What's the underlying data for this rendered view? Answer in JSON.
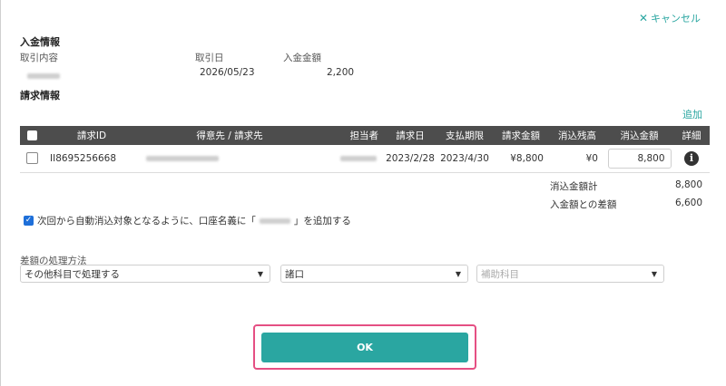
{
  "header": {
    "cancel_label": "キャンセル"
  },
  "payment_info": {
    "title": "入金情報",
    "col_content": "取引内容",
    "col_date": "取引日",
    "col_amount": "入金金額",
    "date": "2026/05/23",
    "amount": "2,200"
  },
  "billing_info": {
    "title": "請求情報",
    "add_label": "追加",
    "columns": [
      "請求ID",
      "得意先 / 請求先",
      "担当者",
      "請求日",
      "支払期限",
      "請求金額",
      "消込残高",
      "消込金額",
      "詳細"
    ],
    "rows": [
      {
        "id": "II8695256668",
        "invoice_date": "2023/2/28",
        "due_date": "2023/4/30",
        "amount": "¥8,800",
        "balance": "¥0",
        "reconcile_amount": "8,800"
      }
    ],
    "summary": [
      {
        "label": "消込金額計",
        "value": "8,800"
      },
      {
        "label": "入金額との差額",
        "value": "6,600"
      }
    ]
  },
  "auto_reconcile": {
    "text_before": "次回から自動消込対象となるように、口座名義に「",
    "text_after": "」を追加する",
    "checked": true
  },
  "difference": {
    "label": "差額の処理方法",
    "method_value": "その他科目で処理する",
    "account_value": "諸口",
    "sub_account_placeholder": "補助科目"
  },
  "ok_label": "OK",
  "colors": {
    "accent": "#2aa6a1",
    "header_bg": "#4d4d4d",
    "highlight": "#e54f83",
    "checkbox": "#1e6fd9"
  }
}
